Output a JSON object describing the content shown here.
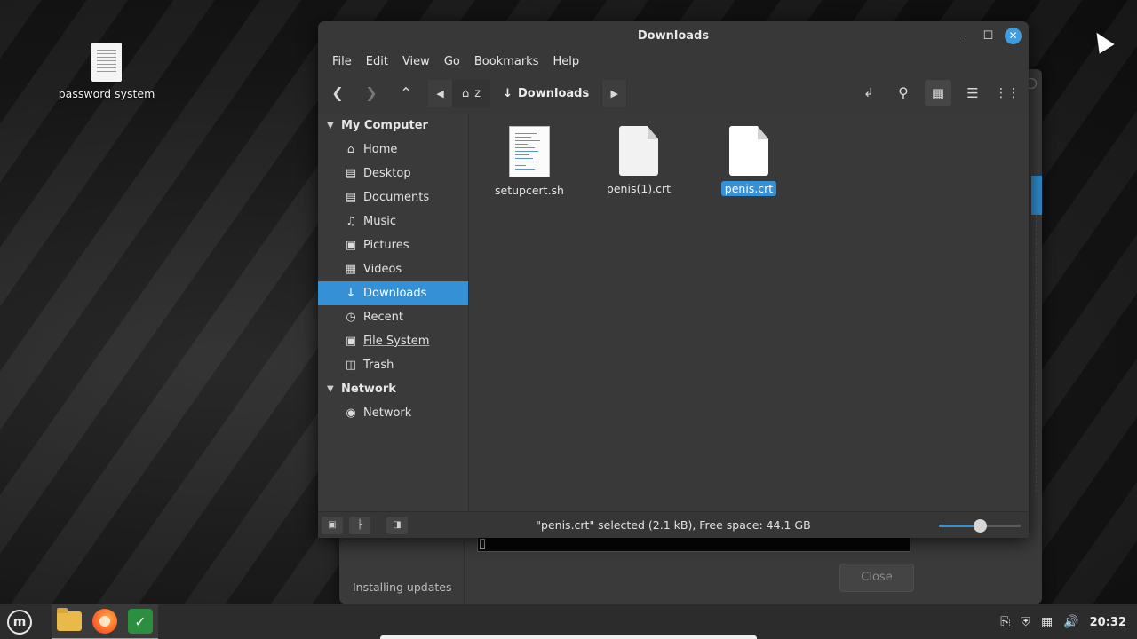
{
  "desktop": {
    "icons": [
      {
        "label": "password system",
        "icon": "text-document-icon"
      }
    ]
  },
  "updater": {
    "status": "Installing updates",
    "close_label": "Close"
  },
  "file_manager": {
    "title": "Downloads",
    "menu": [
      "File",
      "Edit",
      "View",
      "Go",
      "Bookmarks",
      "Help"
    ],
    "path": {
      "home": "z",
      "current": "Downloads"
    },
    "sidebar": {
      "sections": [
        {
          "title": "My Computer",
          "items": [
            {
              "label": "Home",
              "icon": "home-icon"
            },
            {
              "label": "Desktop",
              "icon": "desktop-icon"
            },
            {
              "label": "Documents",
              "icon": "documents-icon"
            },
            {
              "label": "Music",
              "icon": "music-icon"
            },
            {
              "label": "Pictures",
              "icon": "pictures-icon"
            },
            {
              "label": "Videos",
              "icon": "videos-icon"
            },
            {
              "label": "Downloads",
              "icon": "downloads-icon",
              "active": true
            },
            {
              "label": "Recent",
              "icon": "recent-icon"
            },
            {
              "label": "File System",
              "icon": "file-system-icon"
            },
            {
              "label": "Trash",
              "icon": "trash-icon"
            }
          ]
        },
        {
          "title": "Network",
          "items": [
            {
              "label": "Network",
              "icon": "network-icon"
            }
          ]
        }
      ]
    },
    "files": [
      {
        "name": "setupcert.sh",
        "type": "script",
        "selected": false
      },
      {
        "name": "penis(1).crt",
        "type": "certificate",
        "selected": false
      },
      {
        "name": "penis.crt",
        "type": "certificate",
        "selected": true
      }
    ],
    "status_text": "\"penis.crt\" selected (2.1 kB), Free space: 44.1 GB",
    "zoom_level": 0.5
  },
  "taskbar": {
    "apps": [
      "mint-menu-icon",
      "file-manager-icon",
      "firefox-icon",
      "update-manager-icon"
    ],
    "clock": "20:32"
  },
  "colors": {
    "accent": "#3690d6",
    "close_button": "#3f9ce0",
    "window_bg": "#383838"
  }
}
